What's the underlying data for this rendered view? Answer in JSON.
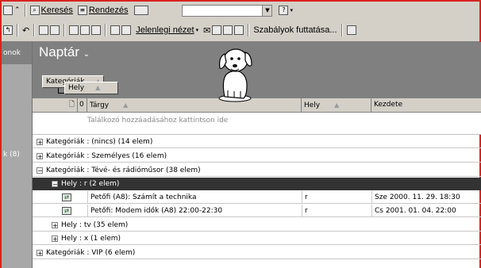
{
  "toolbar1": {
    "search_label": "Keresés",
    "organize_label": "Rendezés",
    "combo_value": ""
  },
  "toolbar2": {
    "current_view_label": "Jelenlegi nézet",
    "run_rules_label": "Szabályok futtatása..."
  },
  "nav": {
    "header_partial": "onok",
    "count_partial": "k (8)"
  },
  "calendar": {
    "title": "Naptár"
  },
  "group_by": {
    "first": "Kategóriák",
    "second": "Hely"
  },
  "columns": {
    "subject": "Tárgy",
    "location": "Hely",
    "start": "Kezdete"
  },
  "add_hint": "Találkozó hozzáadásához kattintson ide",
  "groups": {
    "g1": "Kategóriák : (nincs) (14 elem)",
    "g2": "Kategóriák : Személyes (16 elem)",
    "g3": "Kategóriák : Tévé- és rádióműsor (38 elem)",
    "g3a": "Hely : r (2 elem)",
    "g3b": "Hely : tv (35 elem)",
    "g3c": "Hely : x (1 elem)",
    "g4": "Kategóriák : VIP (6 elem)"
  },
  "items": [
    {
      "subject": "Petőfi (A8): Számít a technika",
      "location": "r",
      "start": "Sze 2000. 11. 29. 18:30"
    },
    {
      "subject": "Petőfi: Modem idők (A8) 22:00-22:30",
      "location": "r",
      "start": "Cs 2001. 01. 04. 22:00"
    }
  ],
  "colors": {
    "frame": "#d9231f",
    "selected_group": "#333333",
    "chrome": "#d4d0c8",
    "header_gray": "#808080"
  }
}
